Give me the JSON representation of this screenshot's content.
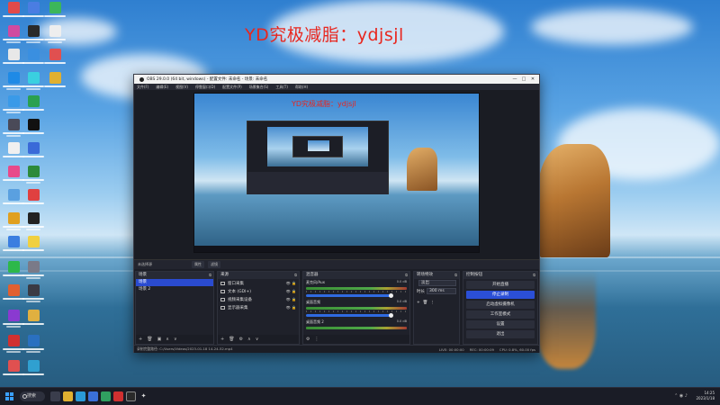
{
  "overlay": {
    "watermark": "YD究极减脂：ydjsjl",
    "preview_watermark": "YD究极减脂：ydjsjl"
  },
  "obs": {
    "title": "OBS 29.0.0 (64 bit, windows) - 配置文件: 未命名 - 场景: 未命名",
    "window_controls": [
      "—",
      "□",
      "✕"
    ],
    "menu": [
      "文件(F)",
      "编辑(E)",
      "视图(V)",
      "停靠窗口(D)",
      "配置文件(P)",
      "场景集合(S)",
      "工具(T)",
      "帮助(H)"
    ],
    "source_strip": {
      "label": "未选择源",
      "props": "属性",
      "filters": "滤镜"
    },
    "scenes": {
      "title": "场景",
      "items": [
        "场景",
        "场景 2"
      ],
      "active": 0
    },
    "sources": {
      "title": "来源",
      "items": [
        "窗口采集",
        "文本 (GDI+)",
        "视频采集设备",
        "显示器采集"
      ]
    },
    "mixer": {
      "title": "混音器",
      "channels": [
        {
          "name": "麦克风/Aux",
          "db": "0.0 dB"
        },
        {
          "name": "桌面音频",
          "db": "0.0 dB"
        },
        {
          "name": "桌面音频 2",
          "db": "0.0 dB"
        }
      ]
    },
    "transitions": {
      "title": "转场特效",
      "type": "淡出",
      "duration_label": "时长",
      "duration": "300 ms"
    },
    "controls": {
      "title": "控制按钮",
      "buttons": [
        "开始直播",
        "停止录制",
        "启动虚拟摄像机",
        "工作室模式",
        "设置",
        "退出"
      ],
      "active_index": 1
    },
    "status": {
      "left": "录制完整路径: C:/Users/Videos/2023-01-18 14-24-52.mp4",
      "live": "LIVE: 00:00:00",
      "rec": "REC: 00:00:09",
      "cpu": "CPU: 0.8%, 60.00 fps"
    }
  },
  "taskbar": {
    "search": "搜索",
    "time": "14:25",
    "date": "2023/1/18"
  }
}
